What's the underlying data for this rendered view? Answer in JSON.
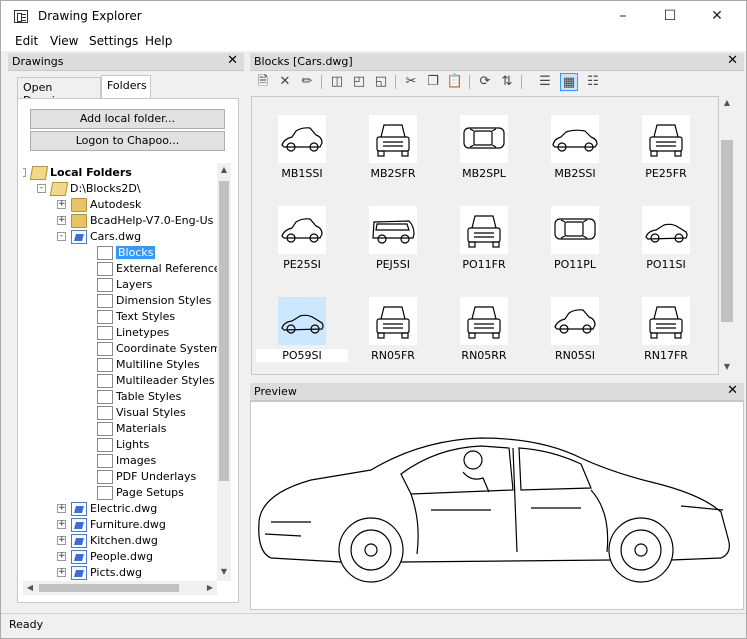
{
  "window": {
    "title": "Drawing Explorer",
    "minimize": "–",
    "maximize": "☐",
    "close": "✕"
  },
  "menu": [
    "Edit",
    "View",
    "Settings",
    "Help"
  ],
  "drawings_panel": {
    "title": "Drawings",
    "close": "✕",
    "tabs": [
      "Open Drawings",
      "Folders"
    ],
    "buttons": [
      "Add local folder...",
      "Logon to Chapoo..."
    ],
    "tree": [
      {
        "label": "Local Folders",
        "bold": true,
        "icon": "folder-open",
        "exp": "-",
        "level": 0
      },
      {
        "label": "D:\\Blocks2D\\",
        "icon": "folder-open",
        "exp": "-",
        "level": 1
      },
      {
        "label": "Autodesk",
        "icon": "folder",
        "exp": "+",
        "level": 2
      },
      {
        "label": "BcadHelp-V7.0-Eng-Us",
        "icon": "folder",
        "exp": "+",
        "level": 2
      },
      {
        "label": "Cars.dwg",
        "icon": "dwg",
        "exp": "-",
        "level": 2
      },
      {
        "label": "Blocks",
        "icon": "style",
        "level": 3,
        "selected": true
      },
      {
        "label": "External References",
        "icon": "style",
        "level": 3
      },
      {
        "label": "Layers",
        "icon": "style",
        "level": 3
      },
      {
        "label": "Dimension Styles",
        "icon": "style",
        "level": 3
      },
      {
        "label": "Text Styles",
        "icon": "style",
        "level": 3
      },
      {
        "label": "Linetypes",
        "icon": "style",
        "level": 3
      },
      {
        "label": "Coordinate Systems",
        "icon": "style",
        "level": 3
      },
      {
        "label": "Multiline Styles",
        "icon": "style",
        "level": 3
      },
      {
        "label": "Multileader Styles",
        "icon": "style",
        "level": 3
      },
      {
        "label": "Table Styles",
        "icon": "style",
        "level": 3
      },
      {
        "label": "Visual Styles",
        "icon": "style",
        "level": 3
      },
      {
        "label": "Materials",
        "icon": "style",
        "level": 3
      },
      {
        "label": "Lights",
        "icon": "style",
        "level": 3
      },
      {
        "label": "Images",
        "icon": "style",
        "level": 3
      },
      {
        "label": "PDF Underlays",
        "icon": "style",
        "level": 3
      },
      {
        "label": "Page Setups",
        "icon": "style",
        "level": 3
      },
      {
        "label": "Electric.dwg",
        "icon": "dwg",
        "exp": "+",
        "level": 2
      },
      {
        "label": "Furniture.dwg",
        "icon": "dwg",
        "exp": "+",
        "level": 2
      },
      {
        "label": "Kitchen.dwg",
        "icon": "dwg",
        "exp": "+",
        "level": 2
      },
      {
        "label": "People.dwg",
        "icon": "dwg",
        "exp": "+",
        "level": 2
      },
      {
        "label": "Picts.dwg",
        "icon": "dwg",
        "exp": "+",
        "level": 2
      }
    ]
  },
  "blocks_panel": {
    "title": "Blocks [Cars.dwg]",
    "close": "✕",
    "toolbar": [
      "new-block",
      "delete",
      "purge",
      "insert",
      "insert-as",
      "insert-copy",
      "cut",
      "copy",
      "paste",
      "refresh",
      "swap",
      "list-view",
      "icon-view",
      "detail-view"
    ],
    "blocks": [
      {
        "name": "MB1SSI",
        "kind": "side"
      },
      {
        "name": "MB2SFR",
        "kind": "front"
      },
      {
        "name": "MB2SPL",
        "kind": "top"
      },
      {
        "name": "MB2SSI",
        "kind": "side-long"
      },
      {
        "name": "PE25FR",
        "kind": "front"
      },
      {
        "name": "PE25SI",
        "kind": "side"
      },
      {
        "name": "PEJ5SI",
        "kind": "van"
      },
      {
        "name": "PO11FR",
        "kind": "front"
      },
      {
        "name": "PO11PL",
        "kind": "top"
      },
      {
        "name": "PO11SI",
        "kind": "sport"
      },
      {
        "name": "PO59SI",
        "kind": "sport",
        "selected": true
      },
      {
        "name": "RN05FR",
        "kind": "front"
      },
      {
        "name": "RN05RR",
        "kind": "front"
      },
      {
        "name": "RN05SI",
        "kind": "side"
      },
      {
        "name": "RN17FR",
        "kind": "front"
      }
    ]
  },
  "preview_panel": {
    "title": "Preview",
    "close": "✕"
  },
  "status": "Ready"
}
